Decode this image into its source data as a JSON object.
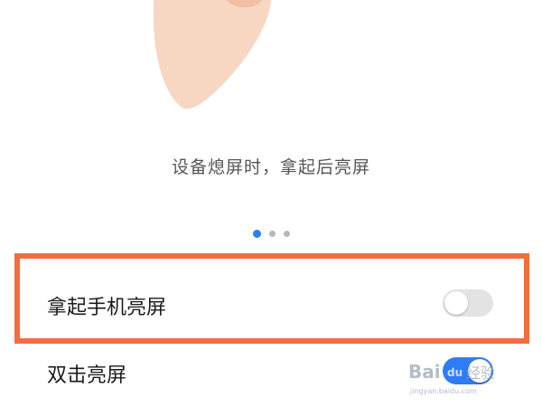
{
  "onboarding": {
    "caption": "设备熄屏时，拿起后亮屏",
    "page_indicator": {
      "current": 1,
      "total": 3
    }
  },
  "settings": {
    "items": [
      {
        "label": "拿起手机亮屏",
        "enabled": false,
        "highlighted": true
      },
      {
        "label": "双击亮屏",
        "enabled": true,
        "highlighted": false
      }
    ]
  },
  "watermark": {
    "text": "Baidu 经验",
    "subtext": "jingyan.baidu.com"
  },
  "colors": {
    "accent": "#2f7cf6",
    "highlight": "#f26e3c",
    "hand": "#f7d6c2"
  }
}
